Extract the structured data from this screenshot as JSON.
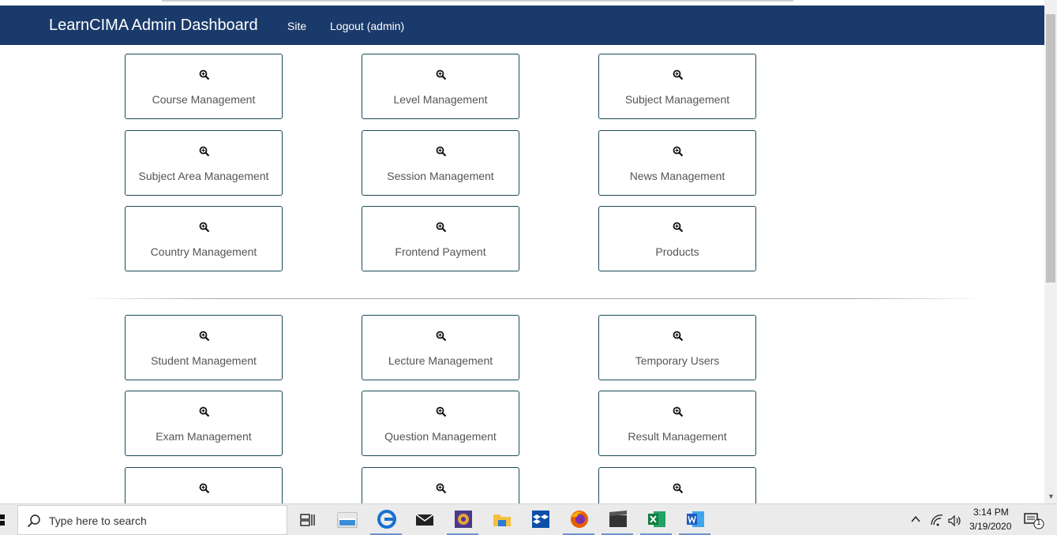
{
  "navbar": {
    "brand": "LearnCIMA Admin Dashboard",
    "links": [
      {
        "label": "Site"
      },
      {
        "label": "Logout (admin)"
      }
    ]
  },
  "cards_section_1": [
    {
      "label": "Course Management",
      "icon": "zoom-in-icon"
    },
    {
      "label": "Level Management",
      "icon": "zoom-in-icon"
    },
    {
      "label": "Subject Management",
      "icon": "zoom-in-icon"
    },
    {
      "label": "Subject Area Management",
      "icon": "zoom-in-icon"
    },
    {
      "label": "Session Management",
      "icon": "zoom-in-icon"
    },
    {
      "label": "News Management",
      "icon": "zoom-in-icon"
    },
    {
      "label": "Country Management",
      "icon": "zoom-in-icon"
    },
    {
      "label": "Frontend Payment",
      "icon": "zoom-in-icon"
    },
    {
      "label": "Products",
      "icon": "zoom-in-icon"
    }
  ],
  "cards_section_2": [
    {
      "label": "Student Management",
      "icon": "zoom-in-icon"
    },
    {
      "label": "Lecture Management",
      "icon": "zoom-in-icon"
    },
    {
      "label": "Temporary Users",
      "icon": "zoom-in-icon"
    },
    {
      "label": "Exam Management",
      "icon": "zoom-in-icon"
    },
    {
      "label": "Question Management",
      "icon": "zoom-in-icon"
    },
    {
      "label": "Result Management",
      "icon": "zoom-in-icon"
    },
    {
      "label": "",
      "icon": "zoom-in-icon"
    },
    {
      "label": "",
      "icon": "zoom-in-icon"
    },
    {
      "label": "",
      "icon": "zoom-in-icon"
    }
  ],
  "taskbar": {
    "search_placeholder": "Type here to search",
    "apps": [
      "task-view-icon",
      "amazon-icon",
      "edge-icon",
      "mail-icon",
      "app-icon",
      "file-explorer-icon",
      "dropbox-icon",
      "firefox-icon",
      "video-icon",
      "excel-icon",
      "word-icon"
    ],
    "clock_time": "3:14 PM",
    "clock_date": "3/19/2020",
    "notification_count": "1"
  },
  "colors": {
    "navbar": "#1a3a6b",
    "card_border": "#1d4a5a"
  }
}
